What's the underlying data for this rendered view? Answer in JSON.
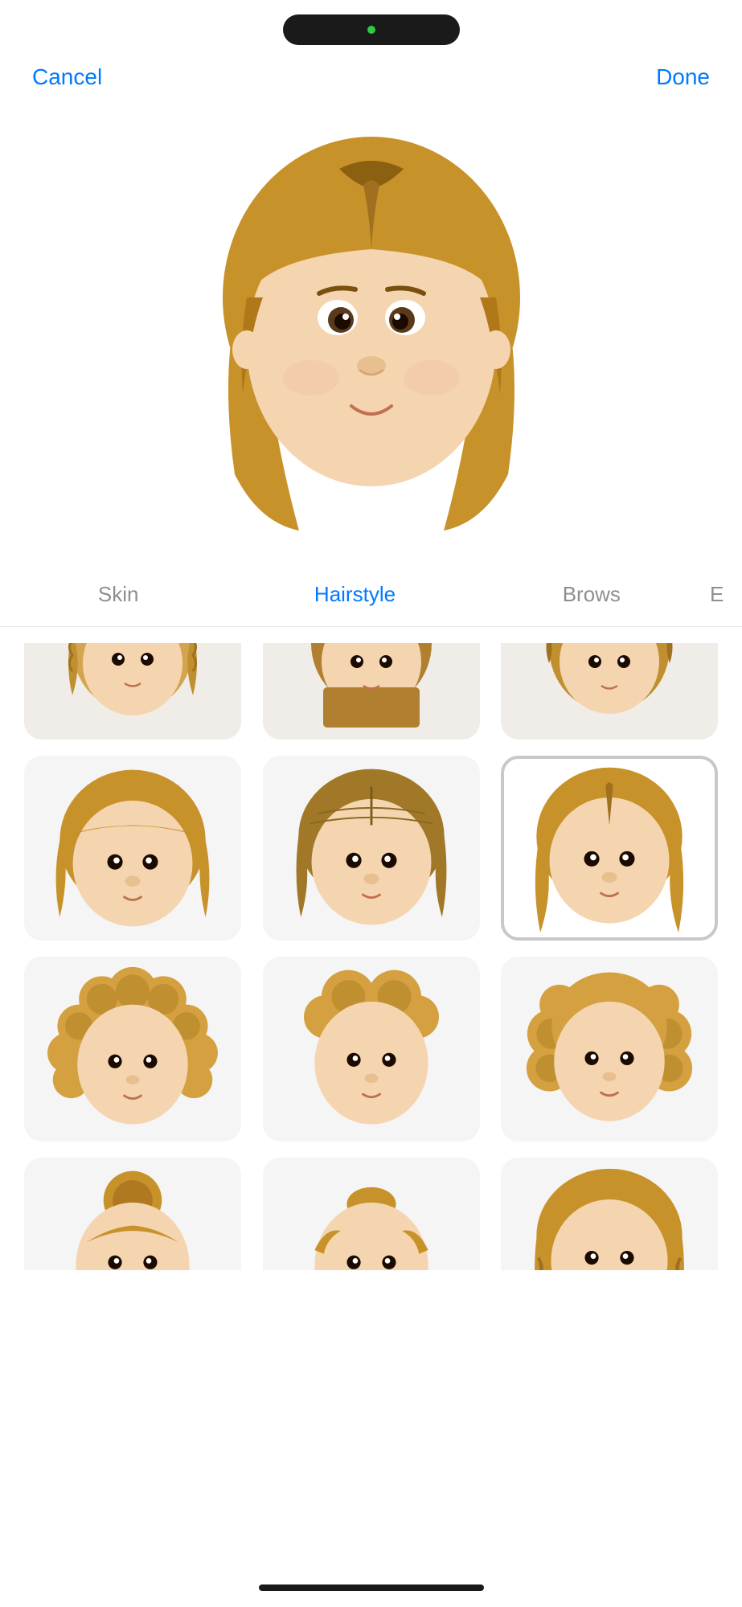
{
  "dynamic_island": {
    "dot_color": "#2ecc40"
  },
  "header": {
    "cancel_label": "Cancel",
    "done_label": "Done"
  },
  "tabs": [
    {
      "id": "skin",
      "label": "Skin",
      "active": false
    },
    {
      "id": "hairstyle",
      "label": "Hairstyle",
      "active": true
    },
    {
      "id": "brows",
      "label": "Brows",
      "active": false
    },
    {
      "id": "more",
      "label": "E",
      "partial": true
    }
  ],
  "hairstyle_grid": {
    "rows": [
      {
        "type": "partial",
        "cells": [
          {
            "id": "h1",
            "selected": false,
            "hair_type": "braided_sides"
          },
          {
            "id": "h2",
            "selected": false,
            "hair_type": "braided_center"
          },
          {
            "id": "h3",
            "selected": false,
            "hair_type": "braided_full"
          }
        ]
      },
      {
        "type": "full",
        "cells": [
          {
            "id": "h4",
            "selected": false,
            "hair_type": "straight_bangs"
          },
          {
            "id": "h5",
            "selected": false,
            "hair_type": "straight_parted"
          },
          {
            "id": "h6",
            "selected": true,
            "hair_type": "straight_long"
          }
        ]
      },
      {
        "type": "full",
        "cells": [
          {
            "id": "h7",
            "selected": false,
            "hair_type": "curly_full"
          },
          {
            "id": "h8",
            "selected": false,
            "hair_type": "curly_top"
          },
          {
            "id": "h9",
            "selected": false,
            "hair_type": "curly_sides"
          }
        ]
      },
      {
        "type": "partial_bottom",
        "cells": [
          {
            "id": "h10",
            "selected": false,
            "hair_type": "updo_bun"
          },
          {
            "id": "h11",
            "selected": false,
            "hair_type": "updo_twist"
          },
          {
            "id": "h12",
            "selected": false,
            "hair_type": "wavy_long"
          }
        ]
      }
    ]
  },
  "home_indicator": {
    "color": "#1a1a1a"
  }
}
